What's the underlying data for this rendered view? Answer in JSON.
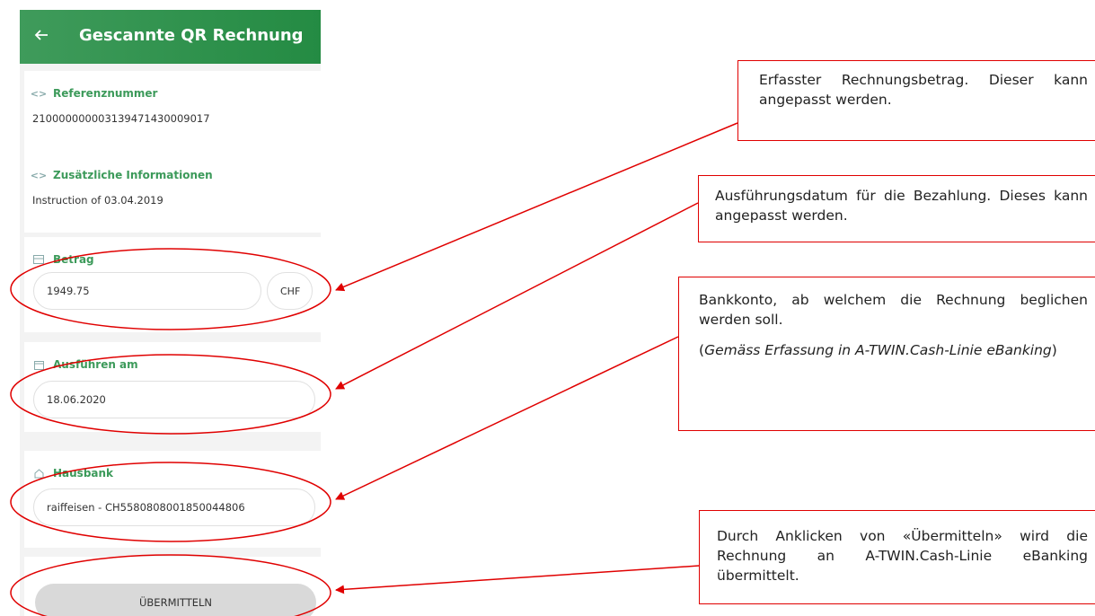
{
  "header": {
    "title": "Gescannte QR Rechnung"
  },
  "reference": {
    "label": "Referenznummer",
    "value": "210000000003139471430009017"
  },
  "additional_info": {
    "label": "Zusätzliche Informationen",
    "value": "Instruction of 03.04.2019"
  },
  "amount": {
    "label": "Betrag",
    "value": "1949.75",
    "currency": "CHF"
  },
  "execute_date": {
    "label": "Ausführen am",
    "value": "18.06.2020"
  },
  "house_bank": {
    "label": "Hausbank",
    "value": "raiffeisen - CH5580808001850044806"
  },
  "submit": {
    "label": "ÜBERMITTELN"
  },
  "annotations": {
    "amount": "Erfasster Rechnungsbetrag. Dieser kann angepasst werden.",
    "date": "Ausführungsdatum für die Bezahlung. Dieses kann angepasst werden.",
    "account_1": "Bankkonto, ab welchem die Rechnung beglichen werden soll.",
    "account_2_open": "(",
    "account_2_italic": "Gemäss Erfassung in A-TWIN.Cash-Linie eBanking",
    "account_2_close": ")",
    "submit": "Durch Anklicken von «Übermitteln» wird die Rechnung an A-TWIN.Cash-Linie eBanking übermittelt."
  },
  "colors": {
    "appbar": "#2a8f48",
    "label_green": "#3c9a5a",
    "annotation_red": "#e00000",
    "button_gray": "#d9d9d9"
  },
  "icons": {
    "back": "arrow-left-icon",
    "reference": "code-brackets-icon",
    "info": "code-brackets-icon",
    "amount": "card-icon",
    "date": "calendar-icon",
    "bank": "home-icon"
  }
}
